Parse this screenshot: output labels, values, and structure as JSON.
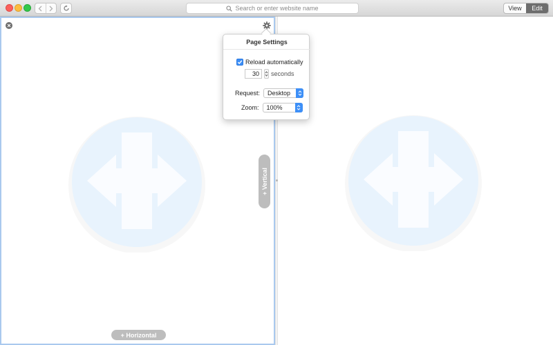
{
  "toolbar": {
    "address_placeholder": "Search or enter website name",
    "mode_view": "View",
    "mode_edit": "Edit",
    "active_mode": "Edit"
  },
  "pane": {
    "vertical_label": "+ Vertical",
    "horizontal_label": "+ Horizontal"
  },
  "popover": {
    "title": "Page Settings",
    "reload_label": "Reload automatically",
    "reload_checked": true,
    "interval_value": "30",
    "interval_unit": "seconds",
    "request_label": "Request:",
    "request_value": "Desktop",
    "zoom_label": "Zoom:",
    "zoom_value": "100%"
  },
  "colors": {
    "accent": "#3d8ff7",
    "pane_border": "#a9c9ee",
    "placeholder_circle": "#e8f3fd"
  },
  "icons": [
    "back-icon",
    "forward-icon",
    "reload-icon",
    "search-icon",
    "close-icon",
    "gear-icon",
    "split-arrows-icon",
    "checkmark-icon",
    "stepper-icon",
    "popup-arrows-icon"
  ]
}
